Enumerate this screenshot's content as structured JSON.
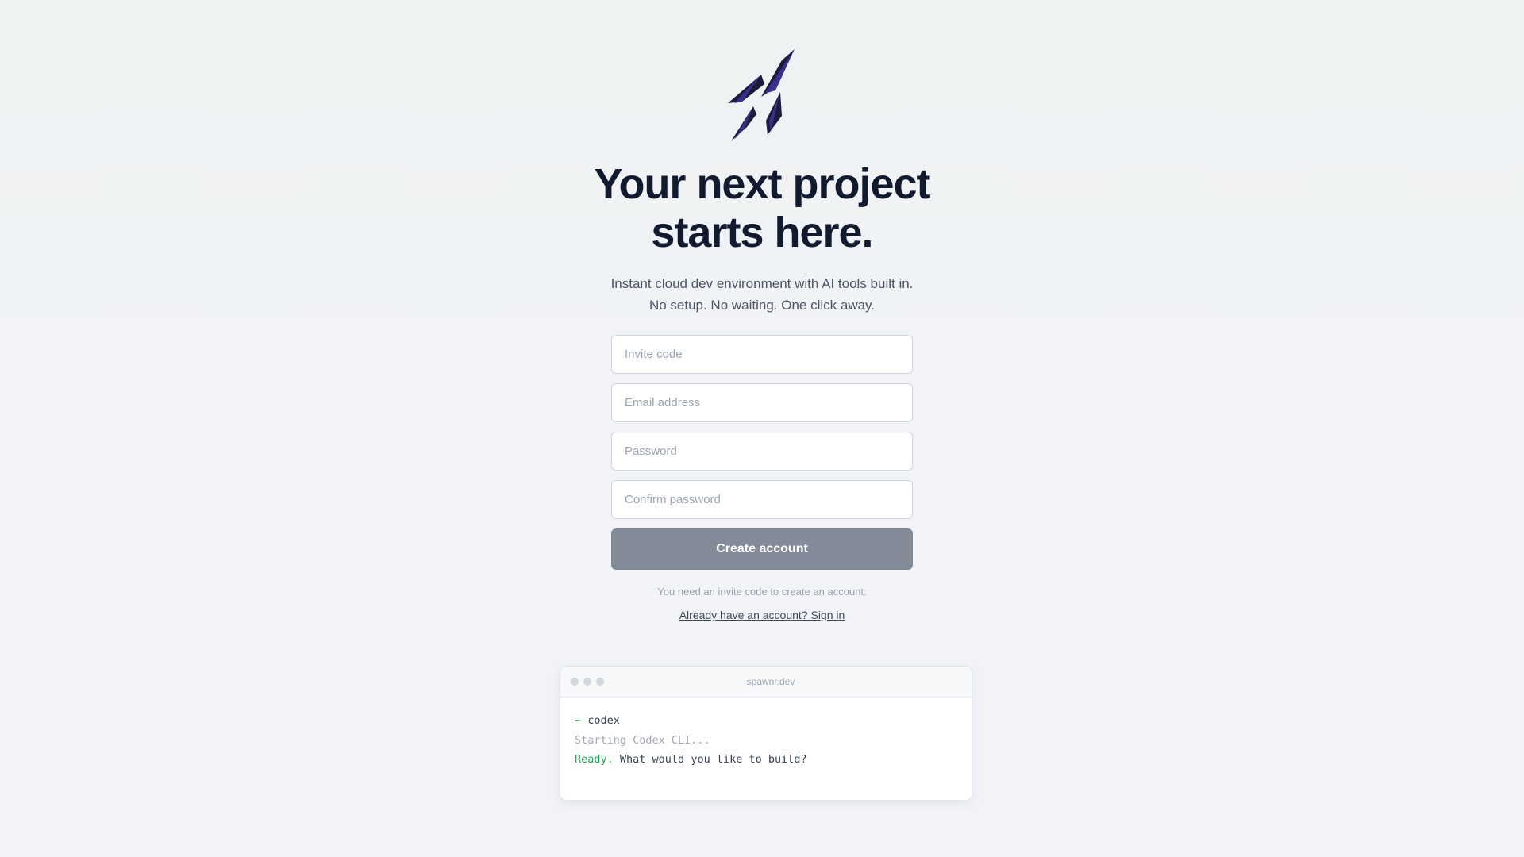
{
  "hero": {
    "headline_line1": "Your next project",
    "headline_line2": "starts here.",
    "subtitle_line1": "Instant cloud dev environment with AI tools built in.",
    "subtitle_line2": "No setup. No waiting. One click away."
  },
  "form": {
    "invite_placeholder": "Invite code",
    "email_placeholder": "Email address",
    "password_placeholder": "Password",
    "confirm_placeholder": "Confirm password",
    "submit_label": "Create account",
    "hint": "You need an invite code to create an account.",
    "signin_link": "Already have an account? Sign in"
  },
  "terminal": {
    "title": "spawnr.dev",
    "prompt_symbol": "~",
    "command": "codex",
    "line2": "Starting Codex CLI...",
    "ready_word": "Ready.",
    "ready_rest": " What would you like to build?"
  },
  "colors": {
    "logo_dark": "#1a1a2e",
    "logo_purple": "#3b2f8f",
    "button_bg": "#838b98",
    "headline": "#111a2e"
  },
  "icons": {
    "logo": "rocket-logo-icon"
  }
}
